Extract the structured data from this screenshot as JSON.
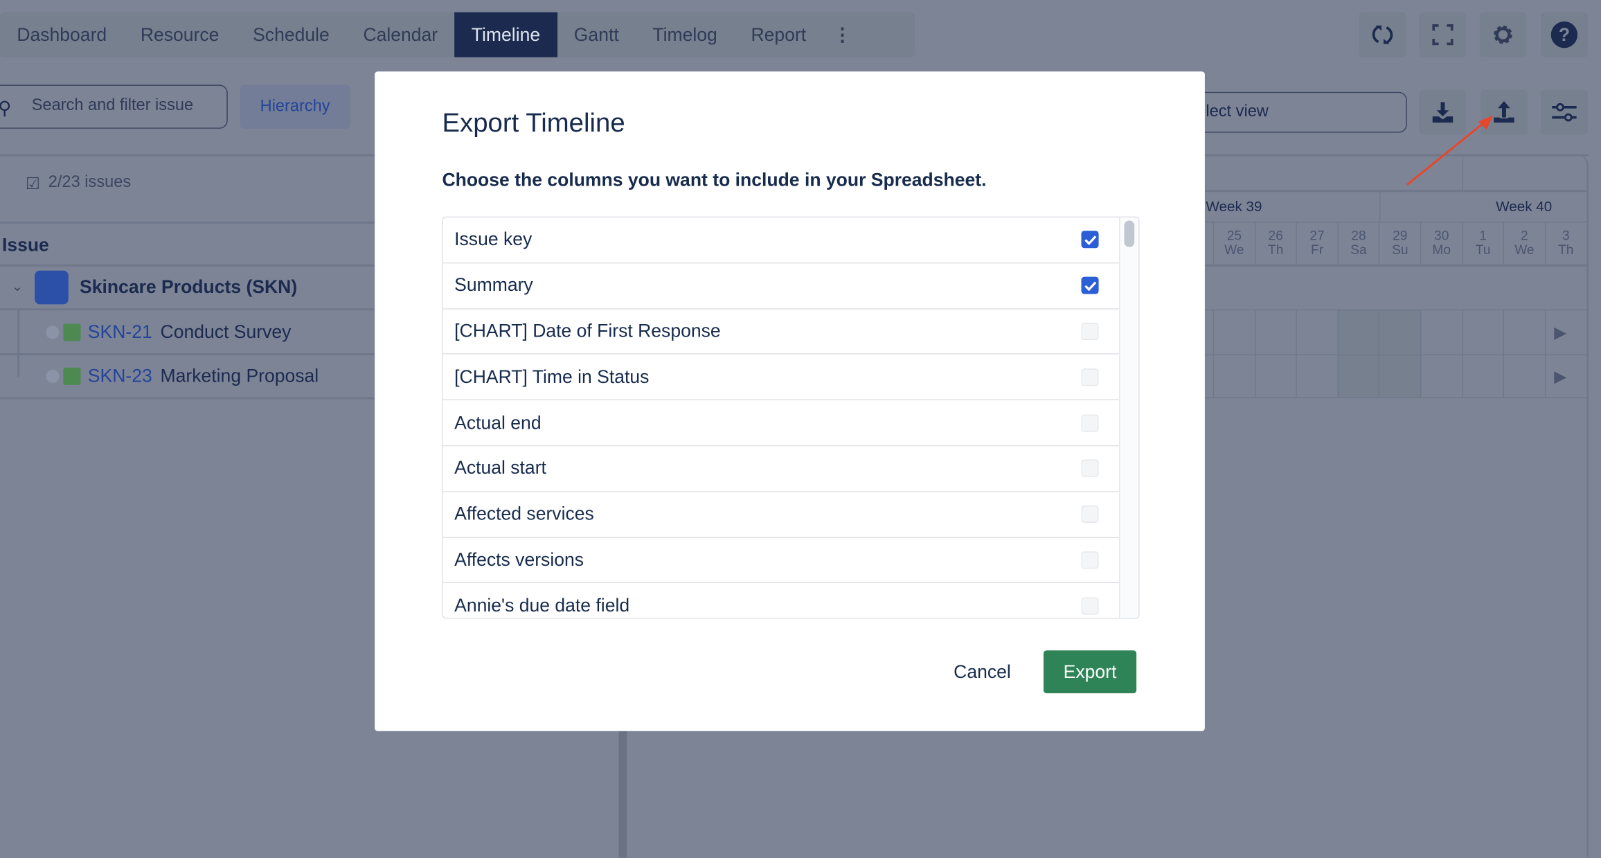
{
  "nav": {
    "tabs": [
      "Dashboard",
      "Resource",
      "Schedule",
      "Calendar",
      "Timeline",
      "Gantt",
      "Timelog",
      "Report"
    ],
    "active": "Timeline"
  },
  "toolbar": {
    "search_placeholder": "Search and filter issue",
    "hierarchy_label": "Hierarchy",
    "view_select": "lect view"
  },
  "issues": {
    "count": "2/23 issues",
    "column_header": "Issue",
    "project": {
      "name": "Skincare Products  (SKN)"
    },
    "items": [
      {
        "key": "SKN-21",
        "summary": "Conduct Survey"
      },
      {
        "key": "SKN-23",
        "summary": "Marketing Proposal"
      }
    ]
  },
  "timeline": {
    "weeks": [
      "Week 39",
      "Week 40"
    ],
    "days": [
      {
        "d": "25",
        "w": "We"
      },
      {
        "d": "26",
        "w": "Th"
      },
      {
        "d": "27",
        "w": "Fr"
      },
      {
        "d": "28",
        "w": "Sa"
      },
      {
        "d": "29",
        "w": "Su"
      },
      {
        "d": "30",
        "w": "Mo"
      },
      {
        "d": "1",
        "w": "Tu"
      },
      {
        "d": "2",
        "w": "We"
      },
      {
        "d": "3",
        "w": "Th"
      }
    ]
  },
  "modal": {
    "title": "Export Timeline",
    "instruction": "Choose the columns you want to include in your Spreadsheet.",
    "columns": [
      {
        "label": "Issue key",
        "checked": true
      },
      {
        "label": "Summary",
        "checked": true
      },
      {
        "label": "[CHART] Date of First Response",
        "checked": false
      },
      {
        "label": "[CHART] Time in Status",
        "checked": false
      },
      {
        "label": "Actual end",
        "checked": false
      },
      {
        "label": "Actual start",
        "checked": false
      },
      {
        "label": "Affected services",
        "checked": false
      },
      {
        "label": "Affects versions",
        "checked": false
      },
      {
        "label": "Annie's due date field",
        "checked": false
      }
    ],
    "cancel_label": "Cancel",
    "export_label": "Export"
  },
  "colors": {
    "primary": "#1b2a4e",
    "export_green": "#2e8456",
    "checkbox": "#2c5ed6",
    "annotation_arrow": "#e8462a"
  }
}
